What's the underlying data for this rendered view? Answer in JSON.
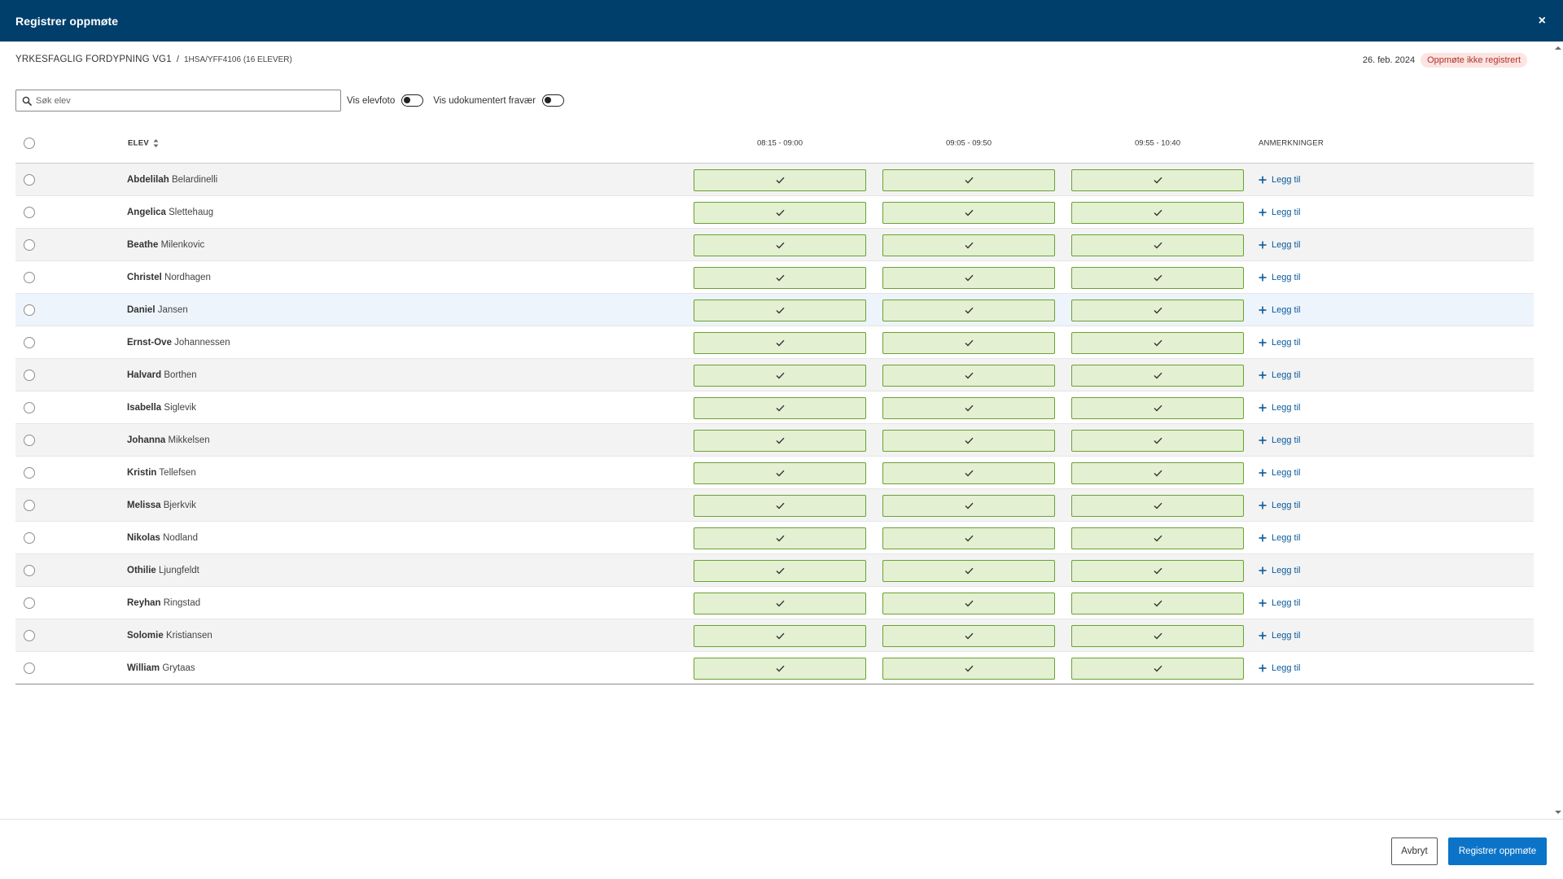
{
  "dialog": {
    "title": "Registrer oppmøte",
    "close_glyph": "×"
  },
  "course": {
    "name": "YRKESFAGLIG FORDYPNING VG1",
    "separator": "/",
    "group": "1HSA/YFF4106 (16 ELEVER)"
  },
  "status": {
    "date": "26. feb. 2024",
    "badge": "Oppmøte ikke registrert",
    "badge_color": "#b0322a",
    "badge_bg": "#fbe4e2"
  },
  "toolbar": {
    "search_placeholder": "Søk elev",
    "search_value": "",
    "toggle_photo_label": "Vis elevfoto",
    "toggle_photo_on": false,
    "toggle_absence_label": "Vis udokumentert fravær",
    "toggle_absence_on": false
  },
  "table": {
    "header_student": "ELEV",
    "periods": [
      "08:15 - 09:00",
      "09:05 - 09:50",
      "09:55 - 10:40"
    ],
    "header_remarks": "ANMERKNINGER",
    "add_label": "Legg til",
    "present_icon": "check-icon",
    "present_color": "#6aa233",
    "present_bg": "#e3f0d2",
    "students": [
      {
        "first": "Abdelilah",
        "last": "Belardinelli"
      },
      {
        "first": "Angelica",
        "last": "Slettehaug"
      },
      {
        "first": "Beathe",
        "last": "Milenkovic"
      },
      {
        "first": "Christel",
        "last": "Nordhagen"
      },
      {
        "first": "Daniel",
        "last": "Jansen"
      },
      {
        "first": "Ernst-Ove",
        "last": "Johannessen"
      },
      {
        "first": "Halvard",
        "last": "Borthen"
      },
      {
        "first": "Isabella",
        "last": "Siglevik"
      },
      {
        "first": "Johanna",
        "last": "Mikkelsen"
      },
      {
        "first": "Kristin",
        "last": "Tellefsen"
      },
      {
        "first": "Melissa",
        "last": "Bjerkvik"
      },
      {
        "first": "Nikolas",
        "last": "Nodland"
      },
      {
        "first": "Othilie",
        "last": "Ljungfeldt"
      },
      {
        "first": "Reyhan",
        "last": "Ringstad"
      },
      {
        "first": "Solomie",
        "last": "Kristiansen"
      },
      {
        "first": "William",
        "last": "Grytaas"
      }
    ]
  },
  "footer": {
    "cancel_label": "Avbryt",
    "submit_label": "Registrer oppmøte",
    "accent": "#0b74c9"
  },
  "theme": {
    "header_bg": "#003f6b"
  }
}
